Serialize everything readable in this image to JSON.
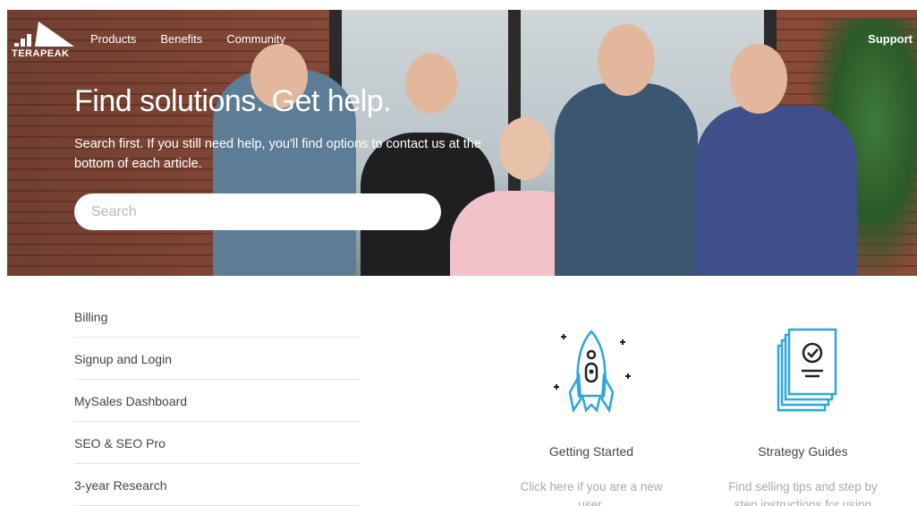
{
  "brand": {
    "name": "TERAPEAK"
  },
  "nav": {
    "items": [
      "Products",
      "Benefits",
      "Community"
    ],
    "support": "Support"
  },
  "hero": {
    "title": "Find solutions. Get help.",
    "subtitle": "Search first. If you still need help, you'll find options to contact us at the bottom of each article.",
    "search_placeholder": "Search"
  },
  "categories": [
    "Billing",
    "Signup and Login",
    "MySales Dashboard",
    "SEO & SEO Pro",
    "3-year Research"
  ],
  "cards": [
    {
      "title": "Getting Started",
      "desc": "Click here if you are a new user."
    },
    {
      "title": "Strategy Guides",
      "desc": "Find selling tips and step by step instructions for using"
    }
  ],
  "colors": {
    "icon_blue": "#2ba6de"
  }
}
